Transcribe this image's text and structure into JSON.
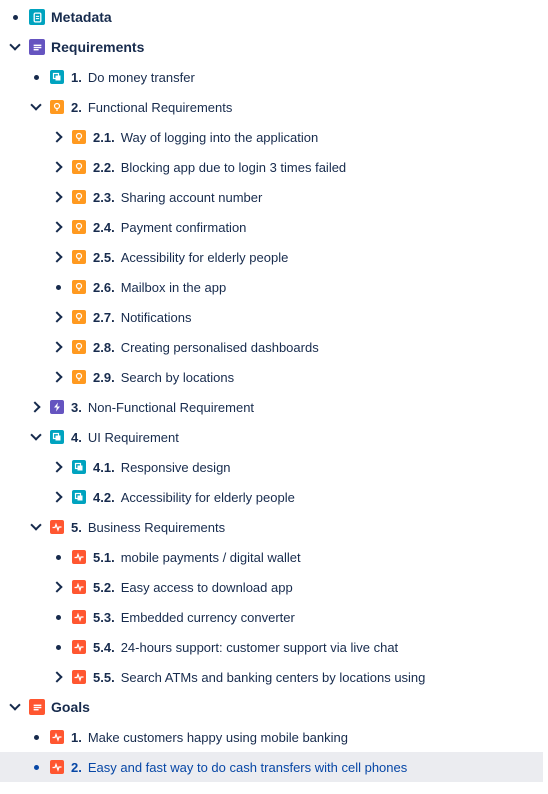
{
  "sections": {
    "metadata": {
      "title": "Metadata",
      "icon": "page-icon",
      "color": "#00a3bf"
    },
    "requirements": {
      "title": "Requirements",
      "icon": "list-icon",
      "color": "#6554c0"
    },
    "goals": {
      "title": "Goals",
      "icon": "list-icon",
      "color": "#ff5630"
    }
  },
  "colors": {
    "story": "#00a3bf",
    "requirement": "#ff991f",
    "nonfunctional": "#6554c0",
    "business": "#ff5630",
    "selected_text": "#0747a6",
    "selected_bg": "#ebecf0"
  },
  "items": {
    "r1": {
      "num": "1.",
      "label": "Do money transfer",
      "icon": "copy-icon"
    },
    "r2": {
      "num": "2.",
      "label": "Functional Requirements",
      "icon": "lightbulb-icon"
    },
    "r2_1": {
      "num": "2.1.",
      "label": "Way of logging into the application",
      "icon": "lightbulb-icon"
    },
    "r2_2": {
      "num": "2.2.",
      "label": "Blocking app due to login 3 times failed",
      "icon": "lightbulb-icon"
    },
    "r2_3": {
      "num": "2.3.",
      "label": "Sharing account number",
      "icon": "lightbulb-icon"
    },
    "r2_4": {
      "num": "2.4.",
      "label": "Payment confirmation",
      "icon": "lightbulb-icon"
    },
    "r2_5": {
      "num": "2.5.",
      "label": "Acessibility for elderly people",
      "icon": "lightbulb-icon"
    },
    "r2_6": {
      "num": "2.6.",
      "label": "Mailbox in the app",
      "icon": "lightbulb-icon"
    },
    "r2_7": {
      "num": "2.7.",
      "label": "Notifications",
      "icon": "lightbulb-icon"
    },
    "r2_8": {
      "num": "2.8.",
      "label": "Creating personalised dashboards",
      "icon": "lightbulb-icon"
    },
    "r2_9": {
      "num": "2.9.",
      "label": "Search by locations",
      "icon": "lightbulb-icon"
    },
    "r3": {
      "num": "3.",
      "label": "Non-Functional Requirement",
      "icon": "lightning-icon"
    },
    "r4": {
      "num": "4.",
      "label": "UI Requirement",
      "icon": "copy-icon"
    },
    "r4_1": {
      "num": "4.1.",
      "label": "Responsive design",
      "icon": "copy-icon"
    },
    "r4_2": {
      "num": "4.2.",
      "label": "Accessibility for elderly people",
      "icon": "copy-icon"
    },
    "r5": {
      "num": "5.",
      "label": "Business Requirements",
      "icon": "pulse-icon"
    },
    "r5_1": {
      "num": "5.1.",
      "label": "mobile payments / digital wallet",
      "icon": "pulse-icon"
    },
    "r5_2": {
      "num": "5.2.",
      "label": "Easy access to download app",
      "icon": "pulse-icon"
    },
    "r5_3": {
      "num": "5.3.",
      "label": "Embedded currency converter",
      "icon": "pulse-icon"
    },
    "r5_4": {
      "num": "5.4.",
      "label": "24-hours support: customer support via live chat",
      "icon": "pulse-icon"
    },
    "r5_5": {
      "num": "5.5.",
      "label": "Search ATMs and banking centers by locations using",
      "icon": "pulse-icon"
    },
    "g1": {
      "num": "1.",
      "label": "Make customers happy using mobile banking",
      "icon": "pulse-icon"
    },
    "g2": {
      "num": "2.",
      "label": "Easy and fast way to do cash transfers with cell phones",
      "icon": "pulse-icon"
    }
  }
}
